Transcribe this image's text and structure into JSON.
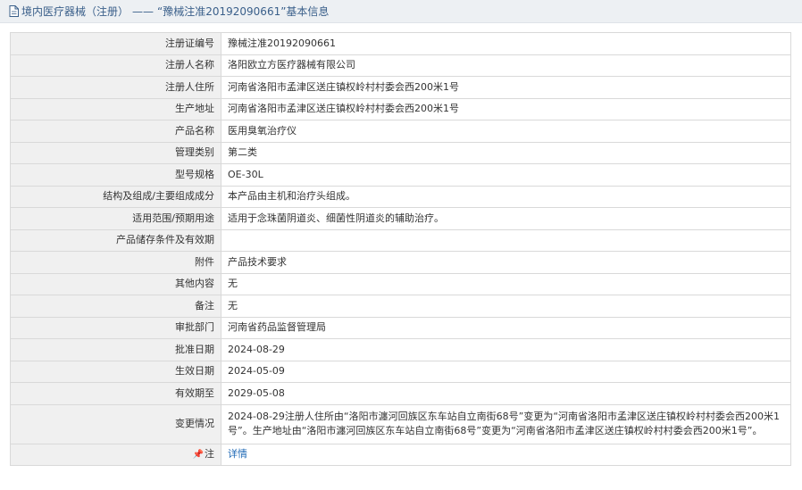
{
  "header": {
    "category": "境内医疗器械（注册）",
    "separator": "——",
    "title": "“豫械注准20192090661”基本信息",
    "icon": "document-icon"
  },
  "rows": [
    {
      "label": "注册证编号",
      "value": "豫械注准20192090661"
    },
    {
      "label": "注册人名称",
      "value": "洛阳欧立方医疗器械有限公司"
    },
    {
      "label": "注册人住所",
      "value": "河南省洛阳市孟津区送庄镇权岭村村委会西200米1号"
    },
    {
      "label": "生产地址",
      "value": "河南省洛阳市孟津区送庄镇权岭村村委会西200米1号"
    },
    {
      "label": "产品名称",
      "value": "医用臭氧治疗仪"
    },
    {
      "label": "管理类别",
      "value": "第二类"
    },
    {
      "label": "型号规格",
      "value": "OE-30L"
    },
    {
      "label": "结构及组成/主要组成成分",
      "value": "本产品由主机和治疗头组成。"
    },
    {
      "label": "适用范围/预期用途",
      "value": "适用于念珠菌阴道炎、细菌性阴道炎的辅助治疗。"
    },
    {
      "label": "产品储存条件及有效期",
      "value": ""
    },
    {
      "label": "附件",
      "value": "产品技术要求"
    },
    {
      "label": "其他内容",
      "value": "无"
    },
    {
      "label": "备注",
      "value": "无"
    },
    {
      "label": "审批部门",
      "value": "河南省药品监督管理局"
    },
    {
      "label": "批准日期",
      "value": "2024-08-29"
    },
    {
      "label": "生效日期",
      "value": "2024-05-09"
    },
    {
      "label": "有效期至",
      "value": "2029-05-08"
    },
    {
      "label": "变更情况",
      "value": "2024-08-29注册人住所由“洛阳市瀍河回族区东车站自立南街68号”变更为“河南省洛阳市孟津区送庄镇权岭村村委会西200米1号”。生产地址由“洛阳市瀍河回族区东车站自立南街68号”变更为“河南省洛阳市孟津区送庄镇权岭村村委会西200米1号”。"
    }
  ],
  "note": {
    "label": "注",
    "icon": "pin-icon",
    "link": "详情"
  },
  "colors": {
    "header_bg": "#edf0f3",
    "label_bg": "#f0f0f0",
    "link": "#1d68b5",
    "border": "#d9d9d9"
  }
}
